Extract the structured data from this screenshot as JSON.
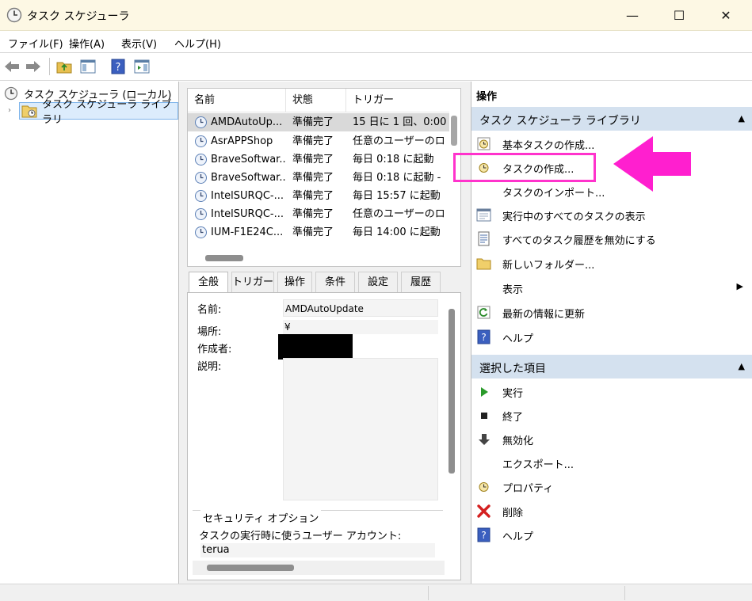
{
  "window": {
    "title": "タスク スケジューラ",
    "min_glyph": "—",
    "max_glyph": "☐",
    "close_glyph": "✕"
  },
  "menu": [
    "ファイル(F)",
    "操作(A)",
    "表示(V)",
    "ヘルプ(H)"
  ],
  "tree": {
    "root": "タスク スケジューラ (ローカル)",
    "library": "タスク スケジューラ ライブラリ"
  },
  "task_list": {
    "columns": [
      "名前",
      "状態",
      "トリガー"
    ],
    "rows": [
      {
        "name": "AMDAutoUp...",
        "status": "準備完了",
        "trigger": "15 日に 1 回、0:00"
      },
      {
        "name": "AsrAPPShop",
        "status": "準備完了",
        "trigger": "任意のユーザーのロ"
      },
      {
        "name": "BraveSoftwar...",
        "status": "準備完了",
        "trigger": "毎日 0:18 に起動"
      },
      {
        "name": "BraveSoftwar...",
        "status": "準備完了",
        "trigger": "毎日 0:18 に起動 -"
      },
      {
        "name": "IntelSURQC-...",
        "status": "準備完了",
        "trigger": "毎日 15:57 に起動"
      },
      {
        "name": "IntelSURQC-...",
        "status": "準備完了",
        "trigger": "任意のユーザーのロ"
      },
      {
        "name": "IUM-F1E24C...",
        "status": "準備完了",
        "trigger": "毎日 14:00 に起動"
      }
    ]
  },
  "detail": {
    "tabs": [
      "全般",
      "トリガー",
      "操作",
      "条件",
      "設定",
      "履歴"
    ],
    "name_label": "名前:",
    "name_value": "AMDAutoUpdate",
    "location_label": "場所:",
    "location_value": "¥",
    "author_label": "作成者:",
    "description_label": "説明:",
    "security_title": "セキュリティ オプション",
    "security_account_label": "タスクの実行時に使うユーザー アカウント:",
    "security_account_value": "terua"
  },
  "actions": {
    "header": "操作",
    "section_library": "タスク スケジューラ ライブラリ",
    "library_items": [
      {
        "label": "基本タスクの作成...",
        "icon": "basic-task-icon"
      },
      {
        "label": "タスクの作成...",
        "icon": "create-task-icon"
      },
      {
        "label": "タスクのインポート...",
        "icon": ""
      },
      {
        "label": "実行中のすべてのタスクの表示",
        "icon": "running-tasks-icon"
      },
      {
        "label": "すべてのタスク履歴を無効にする",
        "icon": "history-icon"
      },
      {
        "label": "新しいフォルダー...",
        "icon": "folder-icon"
      },
      {
        "label": "表示",
        "icon": ""
      },
      {
        "label": "最新の情報に更新",
        "icon": "refresh-icon"
      },
      {
        "label": "ヘルプ",
        "icon": "help-icon"
      }
    ],
    "section_selected": "選択した項目",
    "selected_items": [
      {
        "label": "実行",
        "icon": "run-icon"
      },
      {
        "label": "終了",
        "icon": "stop-icon"
      },
      {
        "label": "無効化",
        "icon": "disable-icon"
      },
      {
        "label": "エクスポート...",
        "icon": ""
      },
      {
        "label": "プロパティ",
        "icon": "properties-icon"
      },
      {
        "label": "削除",
        "icon": "delete-icon"
      },
      {
        "label": "ヘルプ",
        "icon": "help-icon"
      }
    ]
  },
  "colors": {
    "highlight": "#ff33cc",
    "section_bg": "#d4e1ef",
    "titlebar_bg": "#fdf8e4"
  }
}
